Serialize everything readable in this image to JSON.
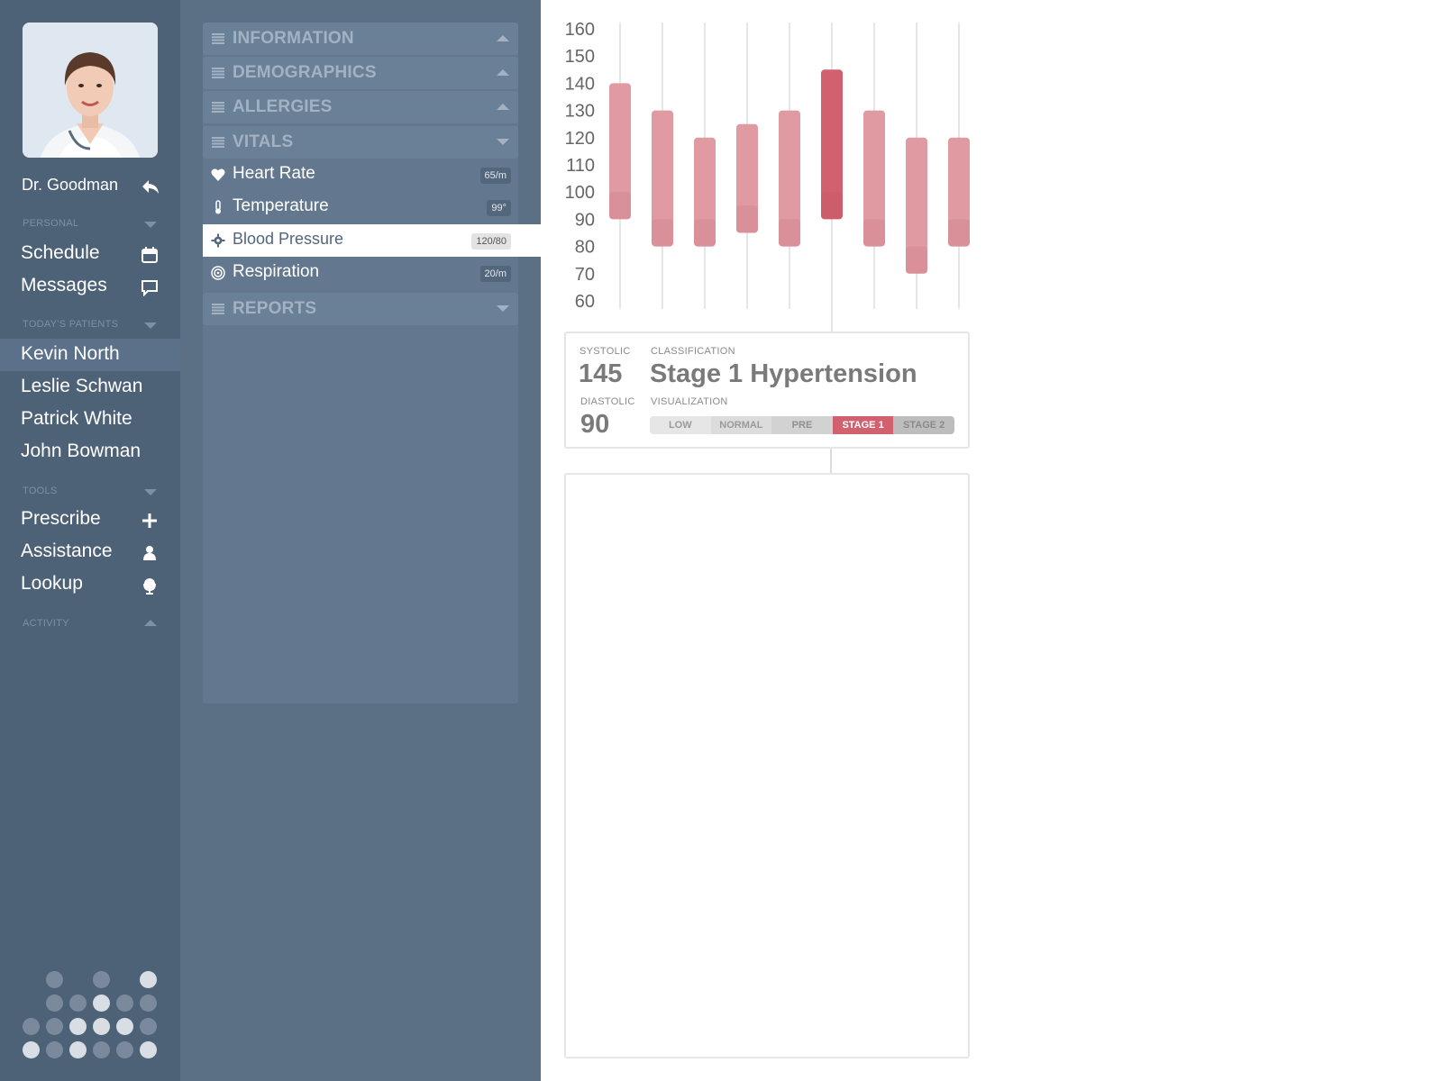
{
  "user": {
    "name": "Dr. Goodman"
  },
  "sidebar": {
    "sections": {
      "personal": "PERSONAL",
      "patients": "TODAY'S PATIENTS",
      "tools": "TOOLS",
      "activity": "ACTIVITY"
    },
    "personal_items": [
      "Schedule",
      "Messages"
    ],
    "patients": [
      "Kevin North",
      "Leslie Schwan",
      "Patrick White",
      "John Bowman"
    ],
    "active_patient": "Kevin North",
    "tools_items": [
      "Prescribe",
      "Assistance",
      "Lookup"
    ]
  },
  "menu": {
    "information": "INFORMATION",
    "demographics": "DEMOGRAPHICS",
    "allergies": "ALLERGIES",
    "vitals": "VITALS",
    "reports": "REPORTS",
    "vital_items": [
      {
        "label": "Heart Rate",
        "value": "65/m",
        "icon": "heart-icon"
      },
      {
        "label": "Temperature",
        "value": "99°",
        "icon": "thermometer-icon"
      },
      {
        "label": "Blood Pressure",
        "value": "120/80",
        "icon": "gear-icon",
        "selected": true
      },
      {
        "label": "Respiration",
        "value": "20/m",
        "icon": "spiral-icon"
      }
    ]
  },
  "chart_data": {
    "type": "bar",
    "ylim": [
      60,
      160
    ],
    "yticks": [
      "160",
      "150",
      "140",
      "130",
      "120",
      "110",
      "100",
      "90",
      "80",
      "70",
      "60"
    ],
    "series": [
      {
        "values": [
          [
            90,
            140
          ],
          [
            80,
            130
          ],
          [
            80,
            120
          ],
          [
            85,
            125
          ],
          [
            80,
            130
          ],
          [
            90,
            145
          ],
          [
            80,
            130
          ],
          [
            70,
            120
          ],
          [
            80,
            120
          ]
        ]
      }
    ],
    "highlight_index": 5,
    "colors": {
      "bar": "#e09aa2",
      "highlight": "#d2616f",
      "grid": "#e6e6e6",
      "tick": "#666666"
    }
  },
  "reading": {
    "systolic_label": "SYSTOLIC",
    "systolic": "145",
    "diastolic_label": "DIASTOLIC",
    "diastolic": "90",
    "classification_label": "CLASSIFICATION",
    "classification": "Stage 1 Hypertension",
    "visualization_label": "VISUALIZATION",
    "scale": [
      "LOW",
      "NORMAL",
      "PRE",
      "STAGE 1",
      "STAGE 2"
    ],
    "active_stage": "STAGE 1"
  },
  "colors": {
    "accent": "#d2616f",
    "sidebar": "#4d6177",
    "panel": "#5b6f85"
  }
}
